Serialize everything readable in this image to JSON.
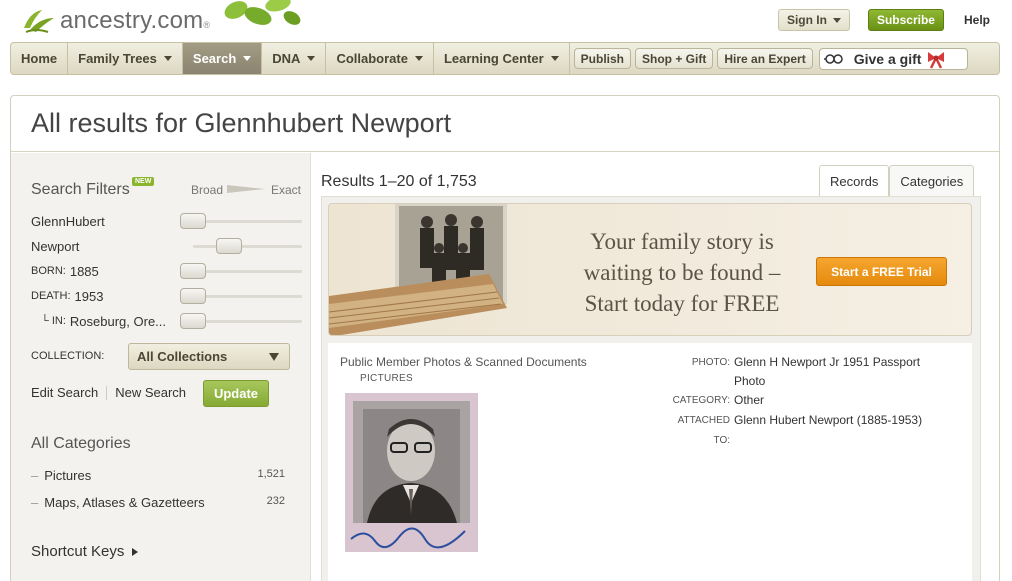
{
  "header": {
    "logo_text": "ancestry.com",
    "logo_reg": "®",
    "signin_label": "Sign In",
    "subscribe_label": "Subscribe",
    "help_label": "Help"
  },
  "nav": {
    "items": [
      "Home",
      "Family Trees",
      "Search",
      "DNA",
      "Collaborate",
      "Learning Center"
    ],
    "pills": [
      "Publish",
      "Shop + Gift",
      "Hire an Expert"
    ],
    "gift_label": "Give a gift"
  },
  "page": {
    "title": "All results for Glennhubert Newport"
  },
  "filters": {
    "title": "Search Filters",
    "new_badge": "NEW",
    "broad": "Broad",
    "exact": "Exact",
    "first_name": "GlennHubert",
    "last_name": "Newport",
    "born_label": "BORN:",
    "born_value": "1885",
    "death_label": "DEATH:",
    "death_value": "1953",
    "in_label": "└ IN:",
    "in_value": "Roseburg, Ore...",
    "collection_label": "COLLECTION:",
    "collection_value": "All Collections",
    "edit_search": "Edit Search",
    "new_search": "New Search",
    "update": "Update"
  },
  "categories": {
    "title": "All Categories",
    "items": [
      {
        "label": "Pictures",
        "count": "1,521"
      },
      {
        "label": "Maps, Atlases & Gazetteers",
        "count": "232"
      }
    ],
    "shortcut_keys": "Shortcut Keys"
  },
  "results": {
    "count_text": "Results 1–20 of 1,753",
    "tabs": [
      "Records",
      "Categories"
    ]
  },
  "banner": {
    "line1": "Your family story is",
    "line2": "waiting to be found –",
    "line3": "Start today for FREE",
    "cta": "Start a FREE Trial"
  },
  "record": {
    "source": "Public Member Photos & Scanned Documents",
    "subtype": "PICTURES",
    "photo_label": "PHOTO:",
    "photo_value_1": "Glenn H Newport Jr 1951 Passport",
    "photo_value_2": "Photo",
    "category_label": "CATEGORY:",
    "category_value": "Other",
    "attached_label": "ATTACHED",
    "attached_label_2": "TO:",
    "attached_value": "Glenn Hubert Newport (1885-1953)"
  }
}
